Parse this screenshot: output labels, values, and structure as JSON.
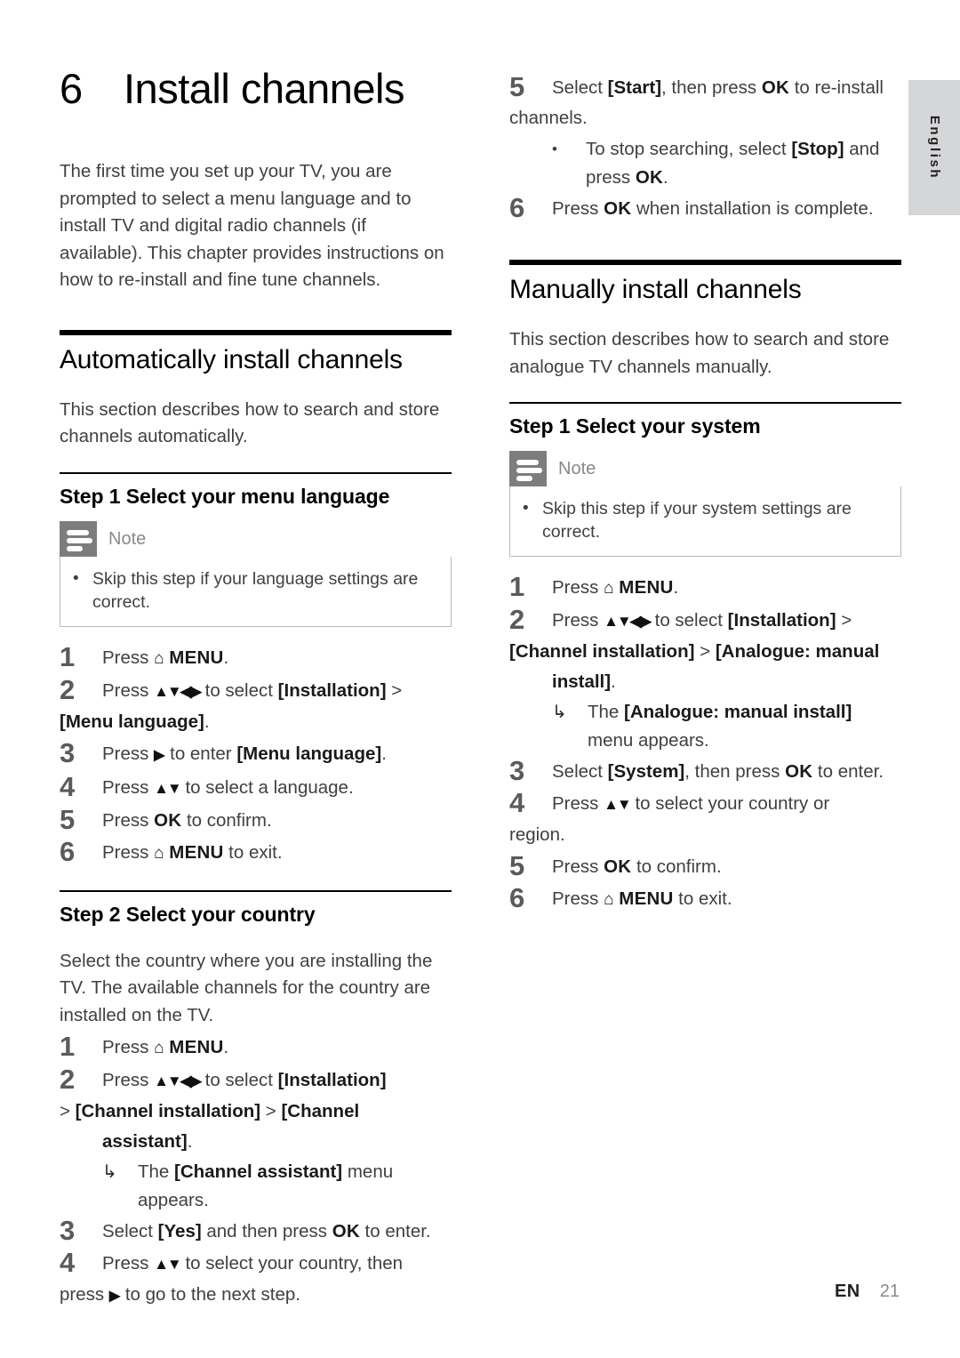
{
  "page": {
    "side_tab_language": "English",
    "footer_locale": "EN",
    "footer_page_number": "21"
  },
  "chapter": {
    "number": "6",
    "title": "Install channels",
    "intro": "The first time you set up your TV, you are prompted to select a menu language and to install TV and digital radio channels (if available). This chapter provides instructions on how to re-install and fine tune channels."
  },
  "left_column": {
    "section": {
      "title": "Automatically install channels",
      "intro": "This section describes how to search and store channels automatically."
    },
    "step1": {
      "title": "Step 1 Select your menu language",
      "note": {
        "label": "Note",
        "bullet": "•",
        "text": "Skip this step if your language settings are correct."
      },
      "items": [
        {
          "num": "1",
          "pre": "Press ",
          "home": "⌂",
          "post": " MENU.",
          "key": "MENU"
        },
        {
          "num": "2",
          "text": "Press ▲▼◀▶ to select [Installation] > [Menu language]."
        },
        {
          "num": "3",
          "text": "Press ▶ to enter [Menu language]."
        },
        {
          "num": "4",
          "text": "Press ▲▼ to select a language."
        },
        {
          "num": "5",
          "text": "Press OK to confirm."
        },
        {
          "num": "6",
          "text": "Press ⌂ MENU to exit."
        }
      ]
    },
    "step2": {
      "title": "Step 2 Select your country",
      "intro": "Select the country where you are installing the TV. The available channels for the country are installed on the TV.",
      "items": [
        {
          "num": "1",
          "text": "Press ⌂ MENU."
        },
        {
          "num": "2",
          "text": "Press ▲▼◀▶ to select [Installation] > [Channel installation] > [Channel assistant].",
          "sub_arrow": "The [Channel assistant] menu appears."
        },
        {
          "num": "3",
          "text": "Select [Yes] and then press OK to enter."
        },
        {
          "num": "4",
          "text": "Press ▲▼ to select your country, then press ▶ to go to the next step."
        }
      ]
    }
  },
  "right_column": {
    "continued_items": [
      {
        "num": "5",
        "text": "Select [Start], then press OK to re-install channels.",
        "sub_bullet": "To stop searching, select [Stop] and press OK."
      },
      {
        "num": "6",
        "text": "Press OK when installation is complete."
      }
    ],
    "section": {
      "title": "Manually install channels",
      "intro": "This section describes how to search and store analogue TV channels manually."
    },
    "step1": {
      "title": "Step 1 Select your system",
      "note": {
        "label": "Note",
        "bullet": "•",
        "text": "Skip this step if your system settings are correct."
      },
      "items": [
        {
          "num": "1",
          "text": "Press ⌂ MENU."
        },
        {
          "num": "2",
          "text": "Press ▲▼◀▶ to select [Installation] > [Channel installation] > [Analogue: manual install].",
          "sub_arrow": "The [Analogue: manual install] menu appears."
        },
        {
          "num": "3",
          "text": "Select [System], then press OK to enter."
        },
        {
          "num": "4",
          "text": "Press ▲▼ to select your country or region."
        },
        {
          "num": "5",
          "text": "Press OK to confirm."
        },
        {
          "num": "6",
          "text": "Press ⌂ MENU to exit."
        }
      ]
    }
  },
  "glyphs": {
    "home": "⌂",
    "arrows_four": "▲▼◀▶",
    "arrows_ud": "▲▼",
    "arrow_right": "▶",
    "sub_arrow": "↳",
    "bullet": "•",
    "gt": ">"
  },
  "labels": {
    "menu_key": "MENU",
    "ok_key": "OK",
    "note": "Note"
  }
}
